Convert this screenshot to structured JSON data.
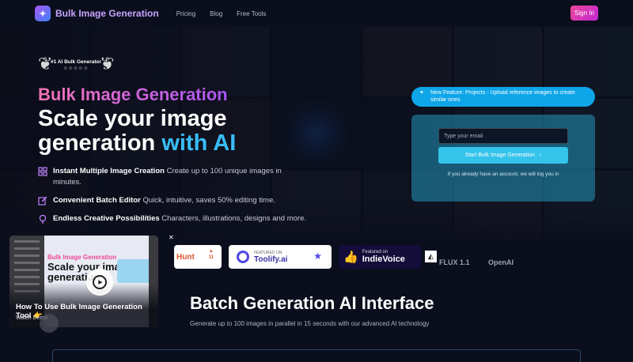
{
  "header": {
    "brand": "Bulk Image Generation",
    "nav": [
      "Pricing",
      "Blog",
      "Free Tools"
    ],
    "sign_in": "Sign In"
  },
  "badge": {
    "text": "#1 AI Bulk Generator",
    "stars": "☆☆☆☆☆"
  },
  "hero": {
    "subtitle": "Bulk Image Generation",
    "title_line1": "Scale your image",
    "title_line2": "generation ",
    "title_accent": "with AI"
  },
  "features": [
    {
      "icon": "grid-icon",
      "bold": "Instant Multiple Image Creation",
      "text": " Create up to 100 unique images in minutes."
    },
    {
      "icon": "edit-icon",
      "bold": "Convenient Batch Editor",
      "text": " Quick, intuitive, saves 50% editing time."
    },
    {
      "icon": "lightbulb-icon",
      "bold": "Endless Creative Possibilities",
      "text": " Characters, illustrations, designs and more."
    }
  ],
  "cta": {
    "pill": "New Feature: Projects - Upload reference images to create similar ones",
    "email_placeholder": "Type your email",
    "button": "Start Bulk Image Generation",
    "note": "If you already have an account, we will log you in"
  },
  "logos": {
    "product_hunt": "Hunt",
    "product_hunt_count": "11",
    "toolify_small": "FEATURED ON",
    "toolify_big": "Toolify.ai",
    "indie_small": "Featured on",
    "indie_big": "IndieVoice",
    "flux": "FLUX 1.1",
    "openai": "OpenAI"
  },
  "video": {
    "screen_title1": "Bulk Image Generation",
    "screen_title2": "Scale your image generation",
    "caption": "How To Use Bulk Image Generation Tool",
    "caption_emoji": "👉",
    "demo": "Watch Demo",
    "close": "✕"
  },
  "batch": {
    "title": "Batch Generation AI Interface",
    "subtitle": "Generate up to 100 images in parallel in 15 seconds with our advanced AI technology"
  },
  "colors": {
    "accent_blue": "#38bdf8",
    "accent_pink": "#ec4899",
    "accent_purple": "#a855f7"
  }
}
